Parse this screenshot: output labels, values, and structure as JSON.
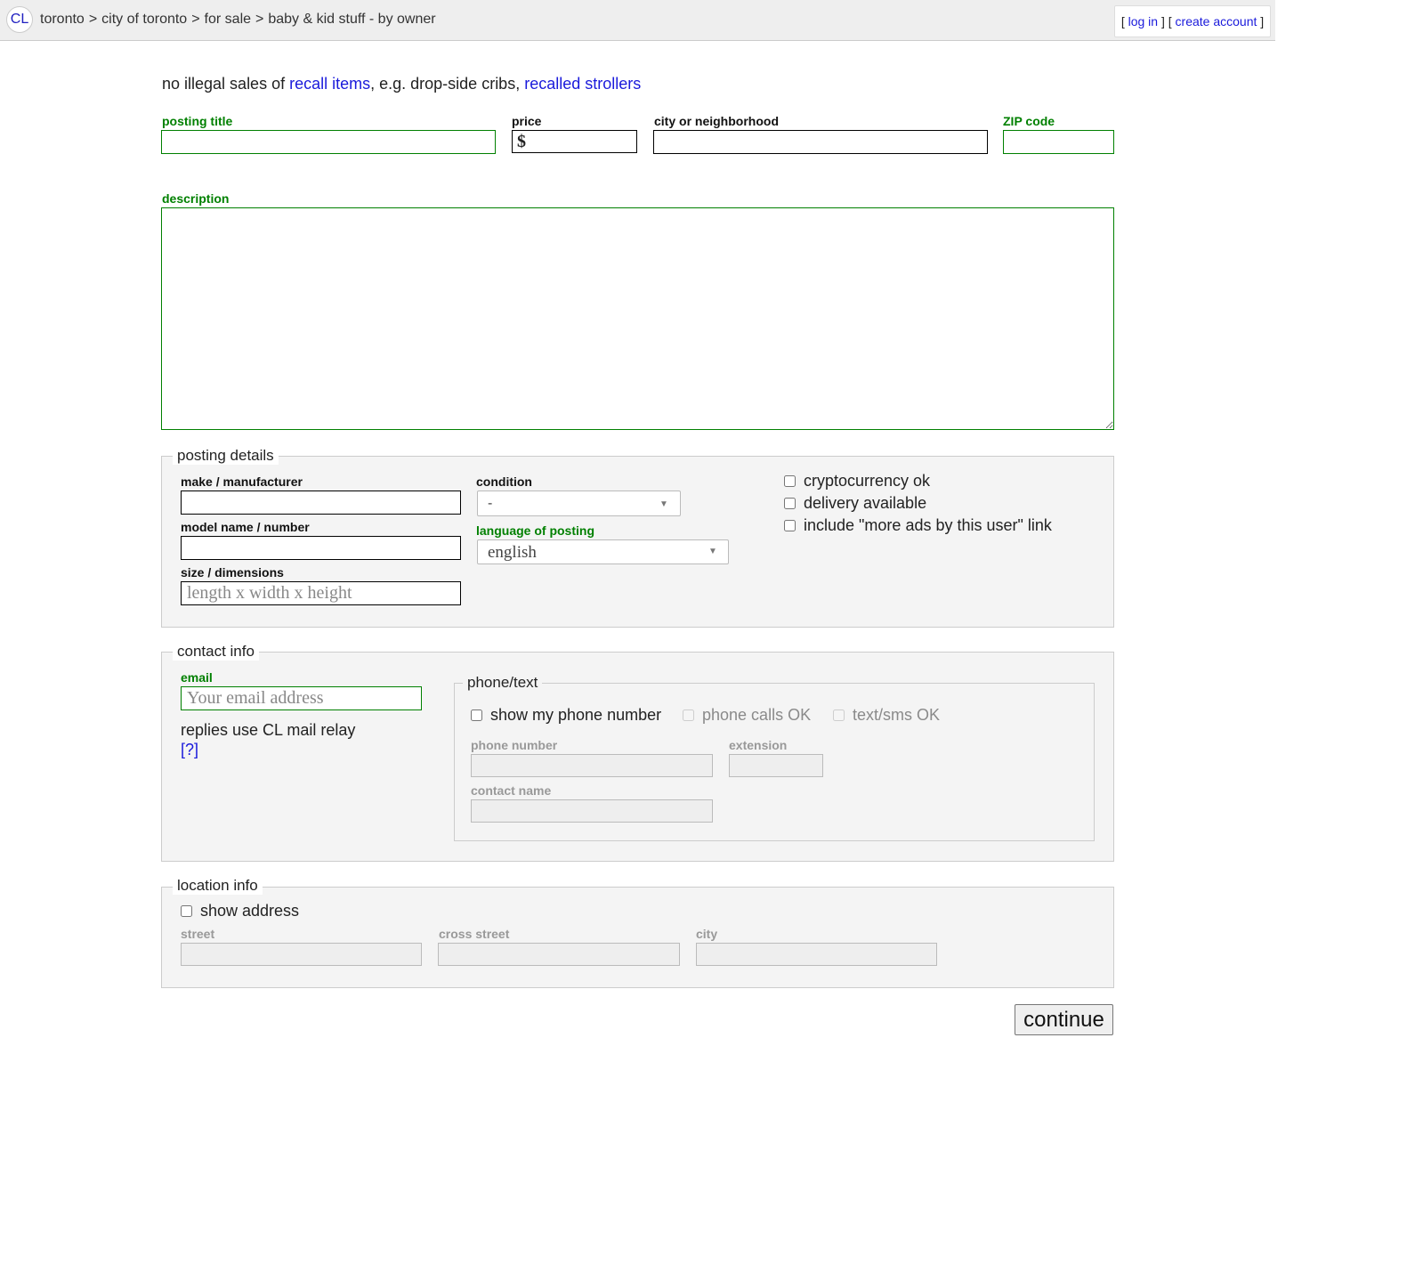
{
  "header": {
    "logo": "CL",
    "breadcrumb": [
      "toronto",
      "city of toronto",
      "for sale",
      "baby & kid stuff - by owner"
    ],
    "breadcrumb_separator": ">",
    "account": {
      "open_bracket": "[",
      "login": "log in",
      "middle": "] [",
      "create": "create account",
      "close_bracket": "]"
    }
  },
  "notice": {
    "prefix": "no illegal sales of ",
    "recall_link": "recall items",
    "middle": ", e.g. drop-side cribs, ",
    "strollers_link": "recalled strollers"
  },
  "form": {
    "posting_title_label": "posting title",
    "price_label": "price",
    "price_symbol": "$",
    "city_label": "city or neighborhood",
    "zip_label": "ZIP code",
    "description_label": "description"
  },
  "posting_details": {
    "legend": "posting details",
    "make_label": "make / manufacturer",
    "model_label": "model name / number",
    "size_label": "size / dimensions",
    "size_placeholder": "length x width x height",
    "condition_label": "condition",
    "condition_value": "-",
    "language_label": "language of posting",
    "language_value": "english",
    "checkboxes": [
      "cryptocurrency ok",
      "delivery available",
      "include \"more ads by this user\" link"
    ]
  },
  "contact_info": {
    "legend": "contact info",
    "email_label": "email",
    "email_placeholder": "Your email address",
    "relay_text": "replies use CL mail relay",
    "relay_help": "[?]",
    "phone": {
      "legend": "phone/text",
      "show_phone": "show my phone number",
      "calls_ok": "phone calls OK",
      "text_ok": "text/sms OK",
      "phone_number_label": "phone number",
      "extension_label": "extension",
      "contact_name_label": "contact name"
    }
  },
  "location_info": {
    "legend": "location info",
    "show_address": "show address",
    "street_label": "street",
    "cross_street_label": "cross street",
    "city_label": "city"
  },
  "continue_label": "continue",
  "colors": {
    "required": "#008000",
    "link": "#1a1adb",
    "topbar": "#eeeeee",
    "fieldset_bg": "#f4f4f4"
  },
  "icons": {
    "select_arrow": "chevron-down-icon"
  }
}
